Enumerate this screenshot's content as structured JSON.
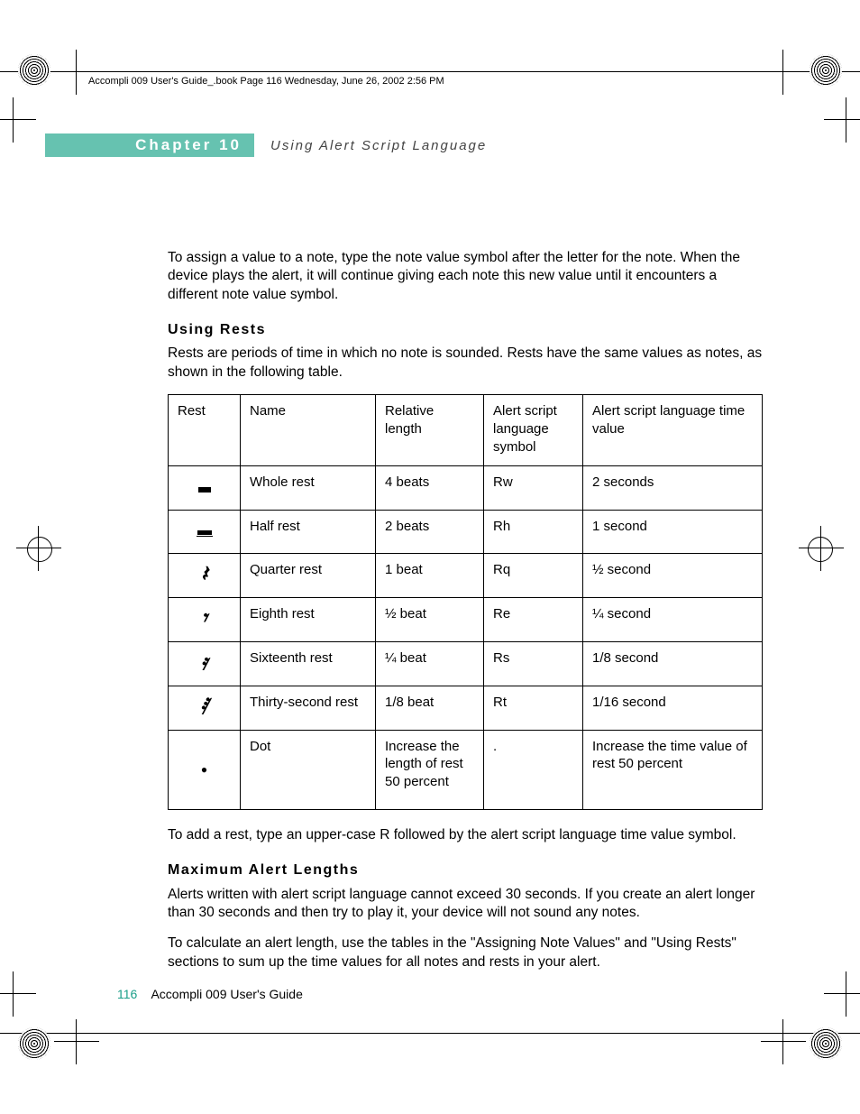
{
  "print_header": "Accompli 009 User's Guide_.book  Page 116  Wednesday, June 26, 2002  2:56 PM",
  "chapter": {
    "label": "Chapter 10",
    "title": "Using Alert Script Language"
  },
  "intro": "To assign a value to a note, type the note value symbol after the letter for the note. When the device plays the alert, it will continue giving each note this new value until it encounters a different note value symbol.",
  "section1": {
    "heading": "Using Rests",
    "p1": "Rests are periods of time in which no note is sounded. Rests have the same values as notes, as shown in the following table.",
    "after": "To add a rest, type an upper-case R followed by the alert script language time value symbol."
  },
  "table": {
    "headers": [
      "Rest",
      "Name",
      "Relative length",
      "Alert script language symbol",
      "Alert script language time value"
    ],
    "rows": [
      {
        "glyph": "whole",
        "name": "Whole rest",
        "len": "4 beats",
        "sym": "Rw",
        "time": "2 seconds"
      },
      {
        "glyph": "half",
        "name": "Half rest",
        "len": "2 beats",
        "sym": "Rh",
        "time": "1 second"
      },
      {
        "glyph": "quarter",
        "name": "Quarter rest",
        "len": "1 beat",
        "sym": "Rq",
        "time": "½ second"
      },
      {
        "glyph": "eighth",
        "name": "Eighth rest",
        "len": "½ beat",
        "sym": "Re",
        "time": "¼ second"
      },
      {
        "glyph": "sixteenth",
        "name": "Sixteenth rest",
        "len": "¼ beat",
        "sym": "Rs",
        "time": "1/8 second"
      },
      {
        "glyph": "thirtysecond",
        "name": "Thirty-second rest",
        "len": "1/8 beat",
        "sym": "Rt",
        "time": "1/16 second"
      },
      {
        "glyph": "dot",
        "name": "Dot",
        "len": "Increase the length of rest 50 percent",
        "sym": ".",
        "time": "Increase the time value of rest 50 per­cent"
      }
    ]
  },
  "section2": {
    "heading": "Maximum Alert Lengths",
    "p1": "Alerts written with alert script language cannot exceed 30 seconds. If you create an alert longer than 30 seconds and then try to play it, your device will not sound any notes.",
    "p2": "To calculate an alert length, use the tables in the \"Assigning Note Values\" and \"Using Rests\" sections to sum up the time values for all notes and rests in your alert."
  },
  "footer": {
    "page": "116",
    "book": "Accompli 009 User's Guide"
  }
}
